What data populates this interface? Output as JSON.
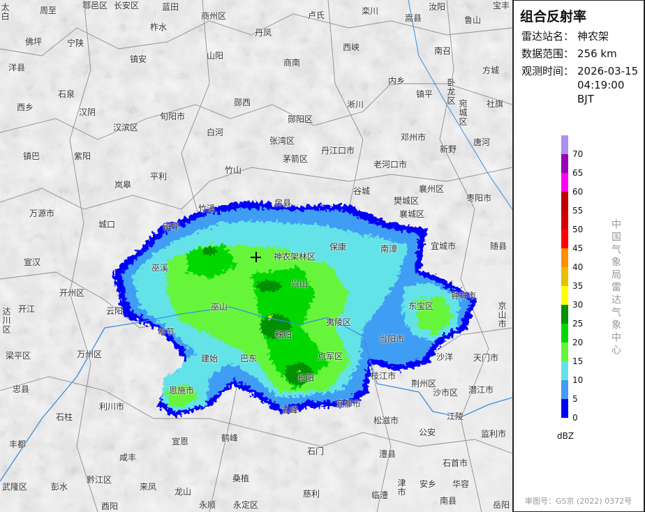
{
  "panel": {
    "title": "组合反射率",
    "station_label": "雷达站名：",
    "station": "神农架",
    "range_label": "数据范围：",
    "range": "256 km",
    "time_label": "观测时间：",
    "date": "2026-03-15",
    "time": "04:19:00 BJT",
    "legend": {
      "unit": "dBZ",
      "ticks": [
        "70",
        "65",
        "60",
        "55",
        "50",
        "45",
        "40",
        "35",
        "30",
        "25",
        "20",
        "15",
        "10",
        "5",
        "0"
      ],
      "colors": [
        "#ad90f0",
        "#9600b4",
        "#ff00f0",
        "#c00000",
        "#d60000",
        "#ff0000",
        "#ff9000",
        "#e7c000",
        "#ffff00",
        "#019000",
        "#00d800",
        "#66f53a",
        "#63e3e8",
        "#419df4",
        "#0000f6"
      ]
    },
    "org": "中国气象局雷达气象中心",
    "approval": "审图号：GS京 (2022) 0372号"
  },
  "map": {
    "radar_site": "神农架",
    "places": [
      "太白",
      "周至",
      "鄠邑区",
      "长安区",
      "蓝田",
      "商州区",
      "卢氏",
      "栾川",
      "嵩县",
      "汝阳",
      "宝丰",
      "佛坪",
      "宁陕",
      "柞水",
      "丹凤",
      "鲁山",
      "洋县",
      "镇安",
      "山阳",
      "商南",
      "西峡",
      "南召",
      "方城",
      "石泉",
      "内乡",
      "镇平",
      "卧龙区",
      "宛城区",
      "社旗",
      "西乡",
      "汉阴",
      "旬阳市",
      "郧西",
      "淅川",
      "汉滨区",
      "白河",
      "郧阳区",
      "邓州市",
      "镇巴",
      "紫阳",
      "张湾区",
      "丹江口市",
      "新野",
      "唐河",
      "茅箭区",
      "老河口市",
      "平利",
      "竹山",
      "岚皋",
      "谷城",
      "襄州区",
      "枣阳市",
      "房县",
      "樊城区",
      "竹溪",
      "万源市",
      "襄城区",
      "城口",
      "镇坪",
      "保康",
      "南漳",
      "宜城市",
      "随县",
      "神农架林区",
      "宣汉",
      "巫溪",
      "兴山",
      "钟祥市",
      "开州区",
      "巫山",
      "东宝区",
      "京山市",
      "开江",
      "云阳",
      "夷陵区",
      "达川区",
      "秭归",
      "奉节",
      "当阳市",
      "梁平区",
      "万州区",
      "建始",
      "巴东",
      "点军区",
      "沙洋",
      "天门市",
      "长阳",
      "忠县",
      "恩施市",
      "枝江市",
      "荆州区",
      "沙市区",
      "潜江市",
      "石柱",
      "利川市",
      "宜都市",
      "五峰",
      "松滋市",
      "江陵",
      "公安",
      "监利市",
      "丰都",
      "宣恩",
      "鹤峰",
      "石门",
      "咸丰",
      "澧县",
      "石首市",
      "黔江区",
      "桑植",
      "来凤",
      "龙山",
      "安乡",
      "华容",
      "武隆区",
      "彭水",
      "慈利",
      "临澧",
      "津市",
      "南县",
      "岳阳",
      "酉阳",
      "永顺",
      "永定区"
    ]
  }
}
